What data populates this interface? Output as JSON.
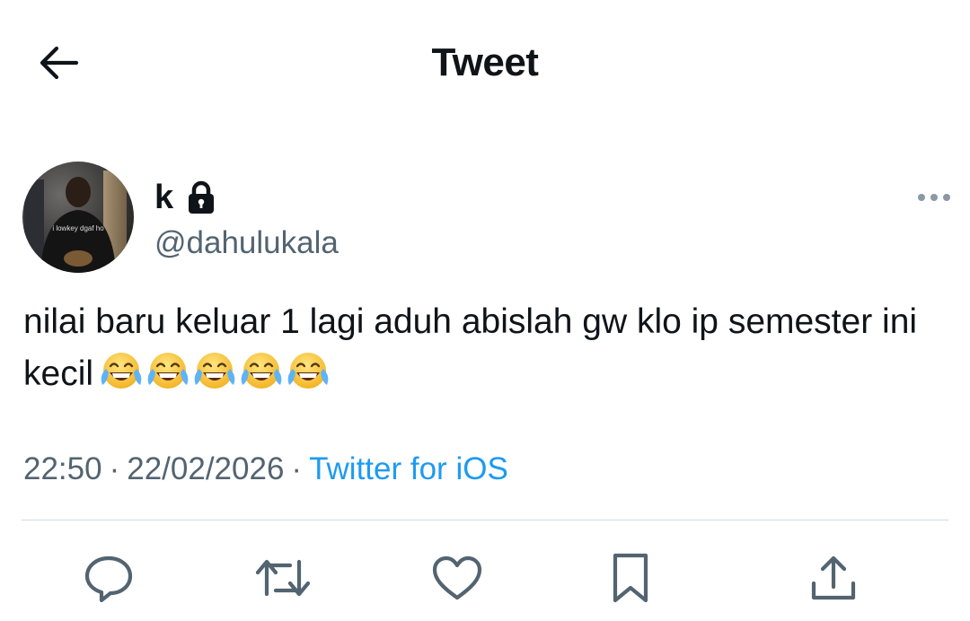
{
  "header": {
    "title": "Tweet",
    "back_icon": "arrow-left-icon"
  },
  "tweet": {
    "author": {
      "display_name": "k",
      "handle": "@dahulukala",
      "protected_icon": "lock-icon",
      "avatar_shirt_text": "i lowkey dgaf ho"
    },
    "text": "nilai baru keluar 1 lagi aduh abislah gw klo ip semester ini kecil",
    "emoji": [
      "😂",
      "😂",
      "😂",
      "😂",
      "😂"
    ],
    "emoji_icon": "face-with-tears-of-joy-icon",
    "time": "22:50",
    "separator": "·",
    "date": "22/02/2026",
    "source": "Twitter for iOS"
  },
  "actions": [
    {
      "name": "reply",
      "icon": "reply-icon"
    },
    {
      "name": "retweet",
      "icon": "retweet-icon"
    },
    {
      "name": "like",
      "icon": "heart-icon"
    },
    {
      "name": "bookmark",
      "icon": "bookmark-icon"
    },
    {
      "name": "share",
      "icon": "share-icon"
    }
  ],
  "colors": {
    "text_primary": "#0f1419",
    "text_secondary": "#536471",
    "accent": "#1d9bf0",
    "divider": "#cfd9de"
  }
}
